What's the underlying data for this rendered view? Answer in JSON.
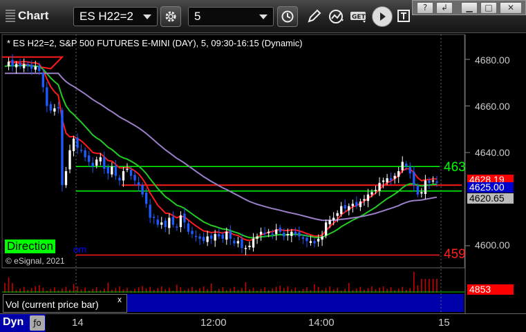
{
  "toolbar": {
    "app_title": "Chart",
    "symbol_value": "ES H22=2",
    "interval_value": "5",
    "settings_icon": "gear-icon",
    "clock_icon": "clock-icon",
    "draw_icon": "pencil-icon",
    "study_icon": "indicator-icon",
    "get_icon": "get-icon",
    "play_icon": "play-icon",
    "text_icon": "text-tool-icon"
  },
  "window": {
    "help": "?",
    "restore_label": "↲",
    "minimize_label": "▁",
    "maximize_label": "□",
    "close_label": "✕"
  },
  "chart_caption": "* ES H22=2, S&P 500 FUTURES E-MINI (DAY), 5, 09:30-16:15 (Dynamic)",
  "copyright": "© eSignal, 2021",
  "direction_label": "Direction",
  "direction_overflow": "om",
  "level_hi_label": "463",
  "level_lo_label": "459",
  "price_axis": [
    "4680.00",
    "4660.00",
    "4640.00",
    "4600.00"
  ],
  "price_tags": {
    "last": "4628.19",
    "current": "4625.00",
    "ma": "4620.65",
    "volume": "4853"
  },
  "volume_pane_label": "Vol (current price bar)",
  "volume_close": "x",
  "time_axis": [
    "14",
    "12:00",
    "14:00",
    "15"
  ],
  "dyn_label": "Dyn",
  "colors": {
    "up": "#ffffff",
    "down": "#1e5bff",
    "red_line": "#ff1a1a",
    "green_line": "#22cc22",
    "purple_line": "#9a7fc8",
    "level_green": "#00ff00"
  },
  "chart_data": {
    "type": "candlestick",
    "symbol": "ES H22=2",
    "interval": "5",
    "ylim": [
      4594,
      4686
    ],
    "y_ticks": [
      4680,
      4660,
      4640,
      4600
    ],
    "horizontal_levels": [
      4634,
      4623.5,
      4626,
      4596
    ],
    "last_price": 4628.19,
    "current_price": 4625.0,
    "moving_average_value": 4620.65,
    "current_volume": 4853
  }
}
